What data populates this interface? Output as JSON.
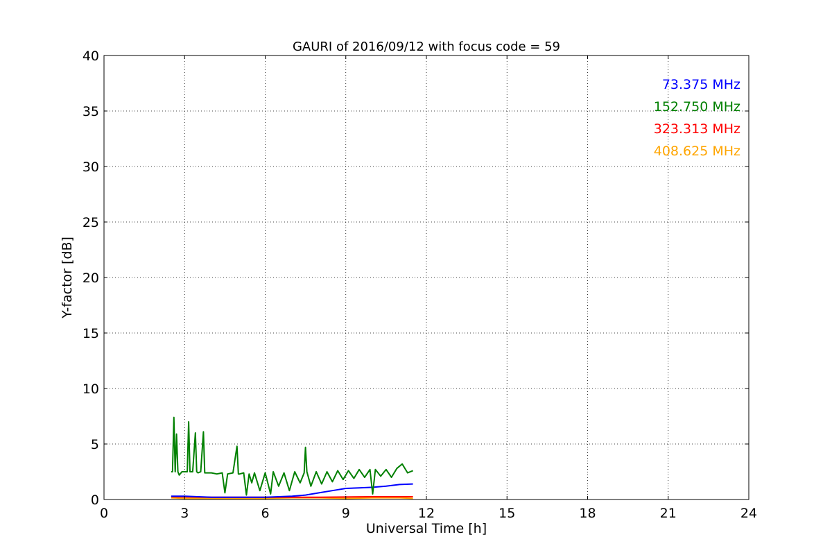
{
  "chart_data": {
    "type": "line",
    "title": "GAURI of 2016/09/12 with focus code = 59",
    "xlabel": "Universal Time [h]",
    "ylabel": "Y-factor [dB]",
    "xlim": [
      0,
      24
    ],
    "ylim": [
      0,
      40
    ],
    "xticks": [
      0,
      3,
      6,
      9,
      12,
      15,
      18,
      21,
      24
    ],
    "yticks": [
      0,
      5,
      10,
      15,
      20,
      25,
      30,
      35,
      40
    ],
    "grid": true,
    "legend_position": "top-right",
    "series": [
      {
        "name": "73.375 MHz",
        "color": "#0000ff",
        "x": [
          2.5,
          3.0,
          3.5,
          4.0,
          4.5,
          5.0,
          5.5,
          6.0,
          6.5,
          7.0,
          7.5,
          8.0,
          8.5,
          9.0,
          9.5,
          10.0,
          10.5,
          11.0,
          11.5
        ],
        "y": [
          0.3,
          0.3,
          0.25,
          0.2,
          0.2,
          0.2,
          0.2,
          0.2,
          0.25,
          0.3,
          0.4,
          0.6,
          0.8,
          1.0,
          1.05,
          1.1,
          1.2,
          1.35,
          1.4
        ]
      },
      {
        "name": "152.750 MHz",
        "color": "#008000",
        "x": [
          2.5,
          2.55,
          2.6,
          2.65,
          2.7,
          2.75,
          2.8,
          2.9,
          3.0,
          3.1,
          3.15,
          3.2,
          3.3,
          3.4,
          3.45,
          3.5,
          3.6,
          3.7,
          3.75,
          3.8,
          4.0,
          4.2,
          4.4,
          4.5,
          4.6,
          4.8,
          4.95,
          5.0,
          5.05,
          5.2,
          5.3,
          5.4,
          5.5,
          5.6,
          5.8,
          6.0,
          6.2,
          6.3,
          6.5,
          6.7,
          6.9,
          7.1,
          7.3,
          7.45,
          7.5,
          7.55,
          7.7,
          7.9,
          8.1,
          8.3,
          8.5,
          8.7,
          8.9,
          9.1,
          9.3,
          9.5,
          9.7,
          9.9,
          10.0,
          10.1,
          10.3,
          10.5,
          10.7,
          10.9,
          11.1,
          11.3,
          11.5
        ],
        "y": [
          2.5,
          2.5,
          7.4,
          2.5,
          5.9,
          2.5,
          2.2,
          2.5,
          2.5,
          2.5,
          7.0,
          2.5,
          2.5,
          6.0,
          2.5,
          2.4,
          2.5,
          6.1,
          2.4,
          2.4,
          2.4,
          2.3,
          2.4,
          0.6,
          2.3,
          2.4,
          4.8,
          2.3,
          2.3,
          2.4,
          0.4,
          2.3,
          1.5,
          2.4,
          0.8,
          2.4,
          0.5,
          2.5,
          1.2,
          2.4,
          0.8,
          2.5,
          1.5,
          2.4,
          4.7,
          2.5,
          1.2,
          2.5,
          1.4,
          2.5,
          1.6,
          2.6,
          1.8,
          2.6,
          1.9,
          2.7,
          2.0,
          2.7,
          0.5,
          2.7,
          2.1,
          2.7,
          2.0,
          2.8,
          3.2,
          2.4,
          2.6
        ]
      },
      {
        "name": "323.313 MHz",
        "color": "#ff0000",
        "x": [
          2.5,
          4.0,
          6.0,
          8.0,
          10.0,
          11.5
        ],
        "y": [
          0.25,
          0.2,
          0.2,
          0.2,
          0.25,
          0.25
        ]
      },
      {
        "name": "408.625 MHz",
        "color": "#ffa500",
        "x": [
          2.5,
          3.0,
          4.0,
          5.0,
          6.0,
          7.0,
          8.0,
          9.0,
          10.0,
          11.0,
          11.5
        ],
        "y": [
          0.15,
          0.1,
          0.1,
          0.1,
          0.1,
          0.15,
          0.15,
          0.1,
          0.15,
          0.15,
          0.1
        ]
      }
    ]
  }
}
